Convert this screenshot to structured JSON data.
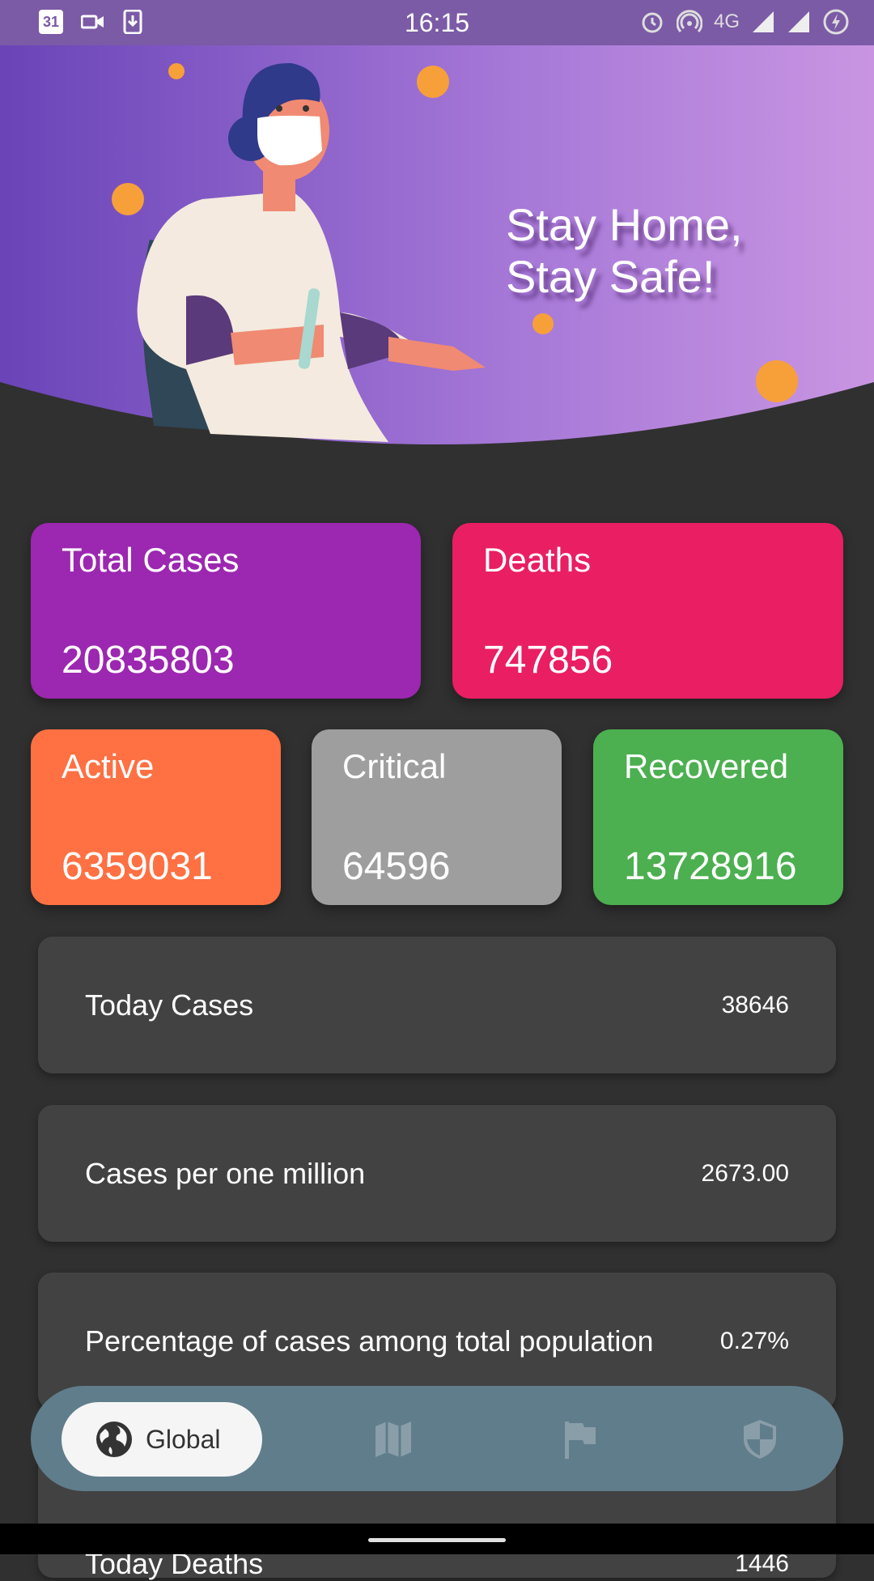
{
  "status_bar": {
    "time": "16:15",
    "network": "4G",
    "left_icons": [
      "calendar-icon",
      "video-icon",
      "download-icon"
    ],
    "calendar_day": "31",
    "right_icons": [
      "alarm-icon",
      "hotspot-icon",
      "signal-icon",
      "signal-icon",
      "battery-charging-icon"
    ]
  },
  "hero": {
    "slogan_line1": "Stay Home,",
    "slogan_line2": "Stay Safe!"
  },
  "cards": {
    "total": {
      "label": "Total Cases",
      "value": "20835803",
      "color": "#9c27b0"
    },
    "deaths": {
      "label": "Deaths",
      "value": "747856",
      "color": "#e91e63"
    },
    "active": {
      "label": "Active",
      "value": "6359031",
      "color": "#ff7043"
    },
    "critical": {
      "label": "Critical",
      "value": "64596",
      "color": "#9e9e9e"
    },
    "recovered": {
      "label": "Recovered",
      "value": "13728916",
      "color": "#4caf50"
    }
  },
  "stats": [
    {
      "label": "Today Cases",
      "value": "38646"
    },
    {
      "label": "Cases per one million",
      "value": "2673.00"
    },
    {
      "label": "Percentage of cases among total population",
      "value": "0.27%"
    },
    {
      "label": "Today Deaths",
      "value": "1446"
    }
  ],
  "bottom_nav": {
    "active_label": "Global",
    "items": [
      "globe-icon",
      "map-icon",
      "flag-icon",
      "shield-icon"
    ],
    "background": "#607d8b"
  }
}
